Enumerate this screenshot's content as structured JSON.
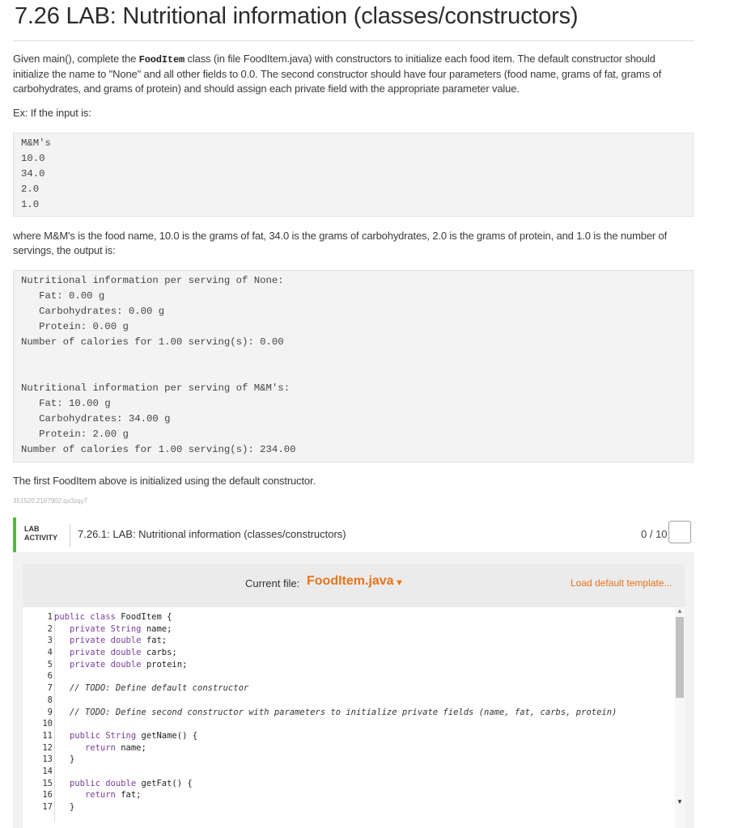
{
  "title": "7.26 LAB: Nutritional information (classes/constructors)",
  "intro": {
    "pre": "Given main(), complete the ",
    "code": "FoodItem",
    "post": " class (in file FoodItem.java) with constructors to initialize each food item. The default constructor should initialize the name to \"None\" and all other fields to 0.0. The second constructor should have four parameters (food name, grams of fat, grams of carbohydrates, and grams of protein) and should assign each private field with the appropriate parameter value."
  },
  "ex_label": "Ex: If the input is:",
  "input_lines": [
    "M&M's",
    "10.0",
    "34.0",
    "2.0",
    "1.0"
  ],
  "where_text": "where M&M's is the food name, 10.0 is the grams of fat, 34.0 is the grams of carbohydrates, 2.0 is the grams of protein, and 1.0 is the number of servings, the output is:",
  "output_lines": [
    "Nutritional information per serving of None:",
    "   Fat: 0.00 g",
    "   Carbohydrates: 0.00 g",
    "   Protein: 0.00 g",
    "Number of calories for 1.00 serving(s): 0.00",
    "",
    "",
    "Nutritional information per serving of M&M's:",
    "   Fat: 10.00 g",
    "   Carbohydrates: 34.00 g",
    "   Protein: 2.00 g",
    "Number of calories for 1.00 serving(s): 234.00"
  ],
  "footnote": "The first FoodItem above is initialized using the default constructor.",
  "tag_id": "351520.2167902.qx3zqy7",
  "lab": {
    "badge_line1": "LAB",
    "badge_line2": "ACTIVITY",
    "title": "7.26.1: LAB: Nutritional information (classes/constructors)",
    "score": "0 / 10",
    "accent_color": "#5bb34a",
    "current_file_label": "Current file:",
    "current_file": "FoodItem.java",
    "load_template": "Load default template...",
    "link_color": "#e8741a"
  },
  "code_lines": [
    "public class FoodItem {",
    "   private String name;",
    "   private double fat;",
    "   private double carbs;",
    "   private double protein;",
    "",
    "   // TODO: Define default constructor",
    "",
    "   // TODO: Define second constructor with parameters to initialize private fields (name, fat, carbs, protein)",
    "",
    "   public String getName() {",
    "      return name;",
    "   }",
    "",
    "   public double getFat() {",
    "      return fat;",
    "   }"
  ]
}
